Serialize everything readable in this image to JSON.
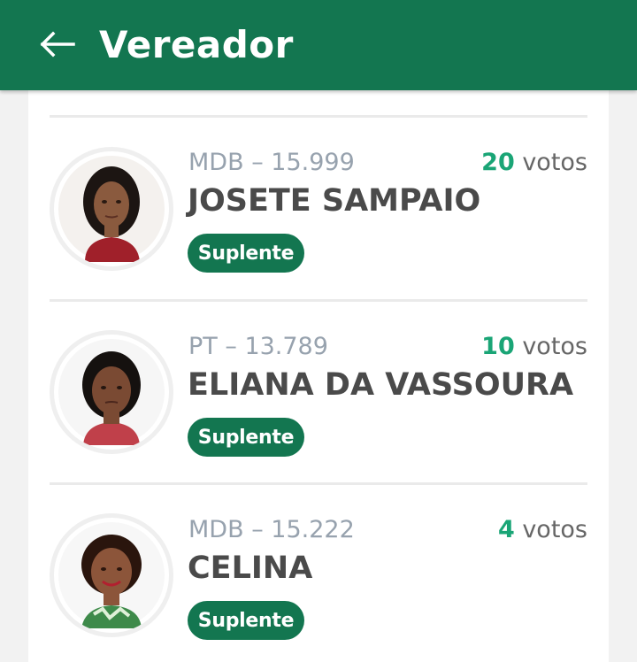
{
  "header": {
    "title": "Vereador",
    "back_icon": "arrow-left-icon",
    "background_color": "#137650"
  },
  "candidates": [
    {
      "party": "MDB – 15.999",
      "name": "JOSETE SAMPAIO",
      "votes_count": "20",
      "votes_label": " votos",
      "status": "Suplente"
    },
    {
      "party": "PT – 13.789",
      "name": "ELIANA DA VASSOURA",
      "votes_count": "10",
      "votes_label": " votos",
      "status": "Suplente"
    },
    {
      "party": "MDB – 15.222",
      "name": "CELINA",
      "votes_count": "4",
      "votes_label": " votos",
      "status": "Suplente"
    }
  ],
  "colors": {
    "accent": "#137650",
    "votes_number": "#1aa576",
    "party_text": "#97a2ae",
    "name_text": "#4a4a4a"
  }
}
